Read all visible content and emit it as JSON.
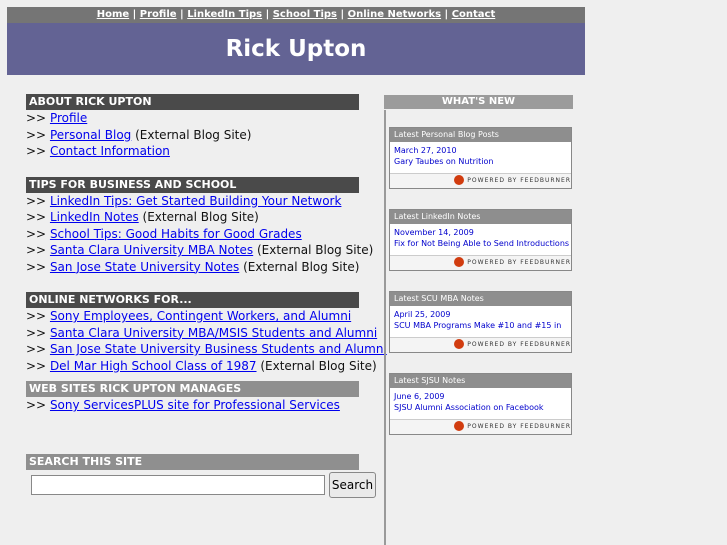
{
  "nav": {
    "items": [
      "Home",
      "Profile",
      "LinkedIn Tips",
      "School Tips",
      "Online Networks",
      "Contact"
    ]
  },
  "banner": {
    "title": "Rick Upton"
  },
  "sections": {
    "about": {
      "heading": "ABOUT RICK UPTON",
      "rows": [
        {
          "prefix": ">>",
          "link": "Profile",
          "suffix": ""
        },
        {
          "prefix": ">>",
          "link": "Personal Blog",
          "suffix": " (External Blog Site)"
        },
        {
          "prefix": ">>",
          "link": "Contact Information",
          "suffix": ""
        }
      ]
    },
    "tips": {
      "heading": "TIPS FOR BUSINESS AND SCHOOL",
      "rows": [
        {
          "prefix": ">>",
          "link": "LinkedIn Tips: Get Started Building Your Network",
          "suffix": ""
        },
        {
          "prefix": ">>",
          "link": "LinkedIn Notes",
          "suffix": " (External Blog Site)"
        },
        {
          "prefix": ">>",
          "link": "School Tips: Good Habits for Good Grades",
          "suffix": ""
        },
        {
          "prefix": ">>",
          "link": "Santa Clara University MBA Notes",
          "suffix": " (External Blog Site)"
        },
        {
          "prefix": ">>",
          "link": "San Jose State University Notes",
          "suffix": " (External Blog Site)"
        }
      ]
    },
    "networks": {
      "heading": "ONLINE NETWORKS FOR...",
      "rows": [
        {
          "prefix": ">>",
          "link": "Sony Employees, Contingent Workers, and Alumni",
          "suffix": ""
        },
        {
          "prefix": ">>",
          "link": "Santa Clara University MBA/MSIS Students and Alumni",
          "suffix": ""
        },
        {
          "prefix": ">>",
          "link": "San Jose State University Business Students and Alumni",
          "suffix": ""
        },
        {
          "prefix": ">>",
          "link": "Del Mar High School Class of 1987",
          "suffix": " (External Blog Site)"
        }
      ]
    },
    "websites": {
      "heading": "WEB SITES RICK UPTON MANAGES",
      "rows": [
        {
          "prefix": ">>",
          "link": "Sony ServicesPLUS site for Professional Services",
          "suffix": ""
        }
      ]
    },
    "search": {
      "heading": "SEARCH THIS SITE",
      "value": "",
      "button_label": "Search"
    }
  },
  "sidebar": {
    "heading": "WHAT'S NEW",
    "feeds": [
      {
        "title": "Latest Personal Blog Posts",
        "date": "March 27, 2010",
        "item": "Gary Taubes on Nutrition",
        "powered": "POWERED BY FEEDBURNER"
      },
      {
        "title": "Latest LinkedIn Notes",
        "date": "November 14, 2009",
        "item": "Fix for Not Being Able to Send Introductions",
        "powered": "POWERED BY FEEDBURNER"
      },
      {
        "title": "Latest SCU MBA Notes",
        "date": "April 25, 2009",
        "item": "SCU MBA Programs Make #10 and #15 in",
        "powered": "POWERED BY FEEDBURNER"
      },
      {
        "title": "Latest SJSU Notes",
        "date": "June 6, 2009",
        "item": "SJSU Alumni Association on Facebook",
        "powered": "POWERED BY FEEDBURNER"
      }
    ]
  },
  "colors": {
    "banner": "#636394",
    "nav": "#757575",
    "link": "#0000ee",
    "section_dark": "#4a4a4a",
    "section_mid": "#8f8f8f"
  }
}
